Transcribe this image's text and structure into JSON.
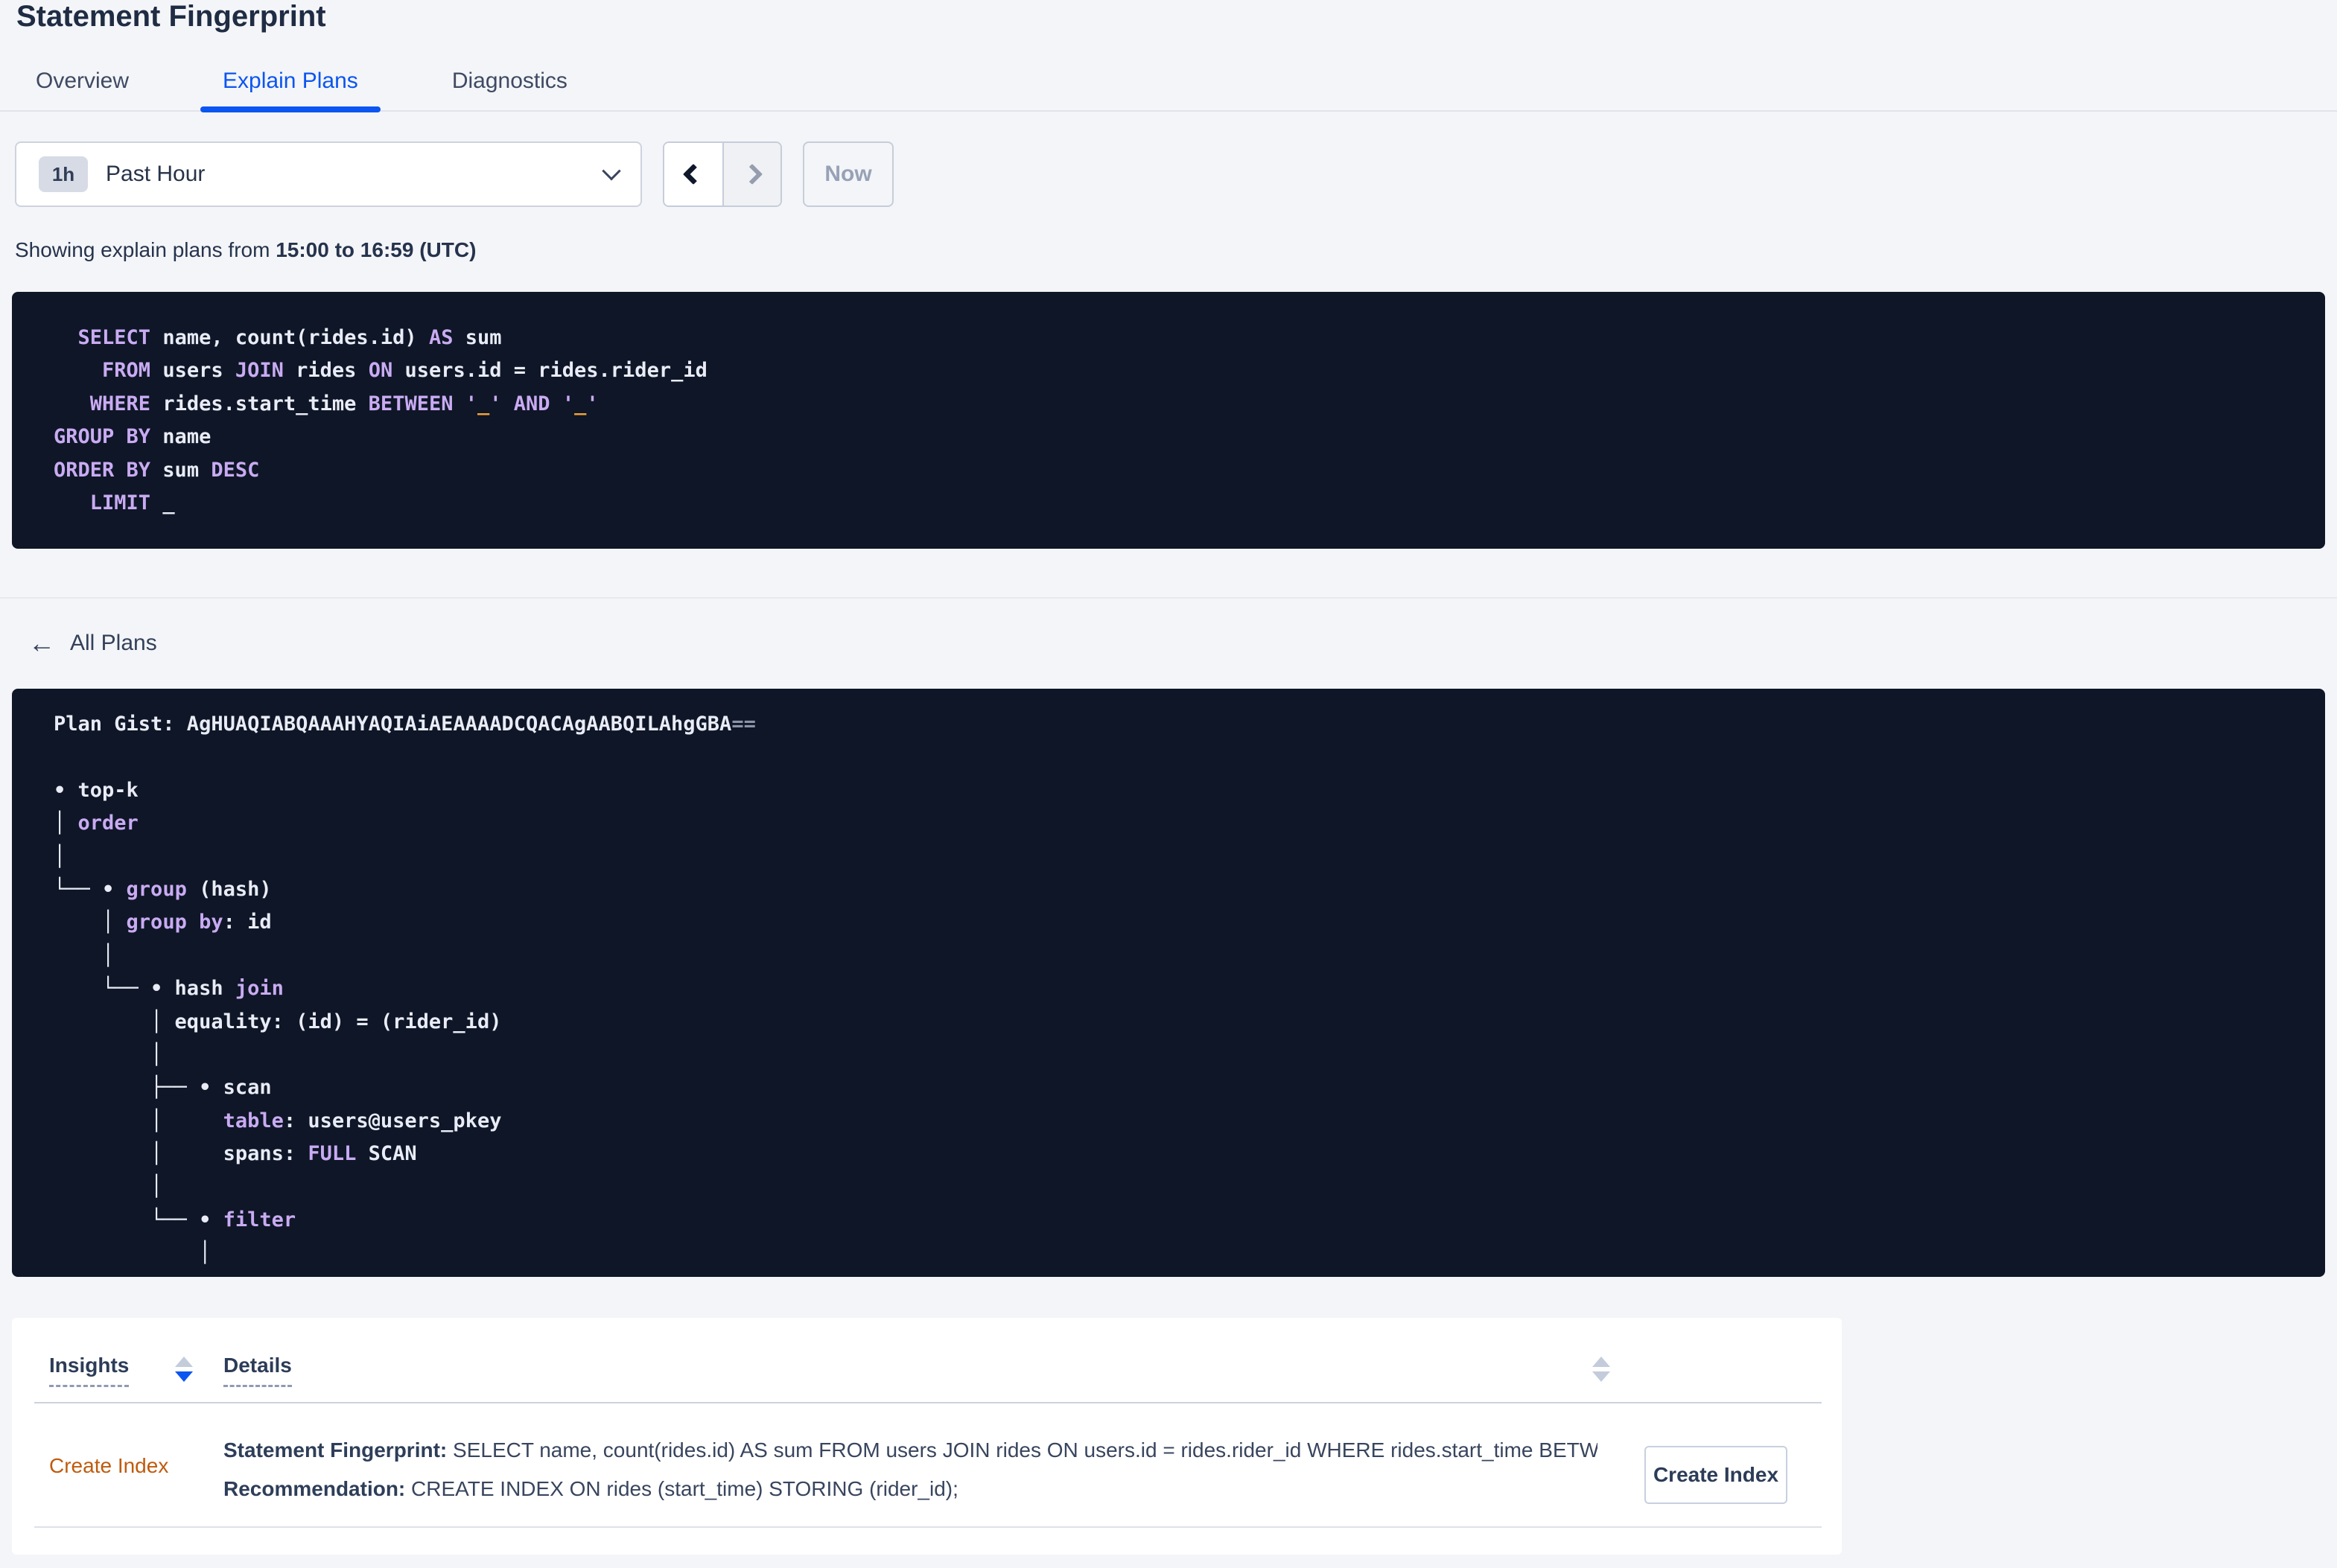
{
  "colors": {
    "page-bg": "#f4f5f8",
    "code-bg": "#0e1627",
    "code-plain": "#e9ecf6",
    "code-keyword": "#c9abf2",
    "code-literal": "#f0a13c",
    "code-dim": "#8b94a9",
    "accent-blue": "#0b55f0",
    "text-dark": "#1f2c44",
    "text-slate": "#33415a",
    "link-orange": "#bf5b0e",
    "border-light": "#ccd3df",
    "disabled-text": "#97a2b6"
  },
  "header": {
    "title": "Statement Fingerprint"
  },
  "tabs": [
    {
      "label": "Overview"
    },
    {
      "label": "Explain Plans"
    },
    {
      "label": "Diagnostics"
    }
  ],
  "time_selector": {
    "badge": "1h",
    "selected": "Past Hour",
    "now_label": "Now"
  },
  "subtitle": {
    "prefix": "Showing explain plans from ",
    "bold_range": "15:00 to 16:59 (UTC)"
  },
  "sql_statement": {
    "lines": [
      [
        [
          "pl",
          "  "
        ],
        [
          "kw",
          "SELECT"
        ],
        [
          "pl",
          " name, count(rides.id) "
        ],
        [
          "kw",
          "AS"
        ],
        [
          "pl",
          " sum"
        ]
      ],
      [
        [
          "pl",
          "    "
        ],
        [
          "kw",
          "FROM"
        ],
        [
          "pl",
          " users "
        ],
        [
          "kw",
          "JOIN"
        ],
        [
          "pl",
          " rides "
        ],
        [
          "kw",
          "ON"
        ],
        [
          "pl",
          " users.id = rides.rider_id"
        ]
      ],
      [
        [
          "pl",
          "   "
        ],
        [
          "kw",
          "WHERE"
        ],
        [
          "pl",
          " rides.start_time "
        ],
        [
          "kw",
          "BETWEEN"
        ],
        [
          "pl",
          " "
        ],
        [
          "kw",
          "'"
        ],
        [
          "lit",
          "_"
        ],
        [
          "kw",
          "'"
        ],
        [
          "pl",
          " "
        ],
        [
          "kw",
          "AND"
        ],
        [
          "pl",
          " "
        ],
        [
          "kw",
          "'"
        ],
        [
          "lit",
          "_"
        ],
        [
          "kw",
          "'"
        ]
      ],
      [
        [
          "kw",
          "GROUP BY"
        ],
        [
          "pl",
          " name"
        ]
      ],
      [
        [
          "kw",
          "ORDER BY"
        ],
        [
          "pl",
          " sum "
        ],
        [
          "kw",
          "DESC"
        ]
      ],
      [
        [
          "pl",
          "   "
        ],
        [
          "kw",
          "LIMIT"
        ],
        [
          "pl",
          " _"
        ]
      ]
    ]
  },
  "plans_nav": {
    "back_arrow": "←",
    "label": "All Plans"
  },
  "plan_detail": {
    "lines": [
      [
        [
          "pl",
          "Plan Gist: AgHUAQIABQAAAHYAQIAiAEAAAADCQACAgAABQILAhgGBA"
        ],
        [
          "dim",
          "=="
        ]
      ],
      [],
      [
        [
          "pl",
          "• top-k"
        ]
      ],
      [
        [
          "pl",
          "│ "
        ],
        [
          "kw",
          "order"
        ]
      ],
      [
        [
          "pl",
          "│"
        ]
      ],
      [
        [
          "pl",
          "└── • "
        ],
        [
          "kw",
          "group"
        ],
        [
          "pl",
          " (hash)"
        ]
      ],
      [
        [
          "pl",
          "    │ "
        ],
        [
          "kw",
          "group by"
        ],
        [
          "pl",
          ": id"
        ]
      ],
      [
        [
          "pl",
          "    │"
        ]
      ],
      [
        [
          "pl",
          "    └── • hash "
        ],
        [
          "kw",
          "join"
        ]
      ],
      [
        [
          "pl",
          "        │ equality: (id) = (rider_id)"
        ]
      ],
      [
        [
          "pl",
          "        │"
        ]
      ],
      [
        [
          "pl",
          "        ├── • scan"
        ]
      ],
      [
        [
          "pl",
          "        │     "
        ],
        [
          "kw",
          "table"
        ],
        [
          "pl",
          ": users@users_pkey"
        ]
      ],
      [
        [
          "pl",
          "        │     spans: "
        ],
        [
          "kw",
          "FULL"
        ],
        [
          "pl",
          " SCAN"
        ]
      ],
      [
        [
          "pl",
          "        │"
        ]
      ],
      [
        [
          "pl",
          "        └── • "
        ],
        [
          "kw",
          "filter"
        ]
      ],
      [
        [
          "pl",
          "            │"
        ]
      ]
    ]
  },
  "insights_table": {
    "columns": [
      "Insights",
      "Details"
    ],
    "row": {
      "insight": "Create Index",
      "fingerprint_label": "Statement Fingerprint:",
      "fingerprint_text": " SELECT name, count(rides.id) AS sum FROM users JOIN rides ON users.id = rides.rider_id WHERE rides.start_time BETWEEN '_…",
      "recommendation_label": "Recommendation:",
      "recommendation_text": " CREATE INDEX ON rides (start_time) STORING (rider_id);",
      "action_label": "Create Index"
    }
  }
}
